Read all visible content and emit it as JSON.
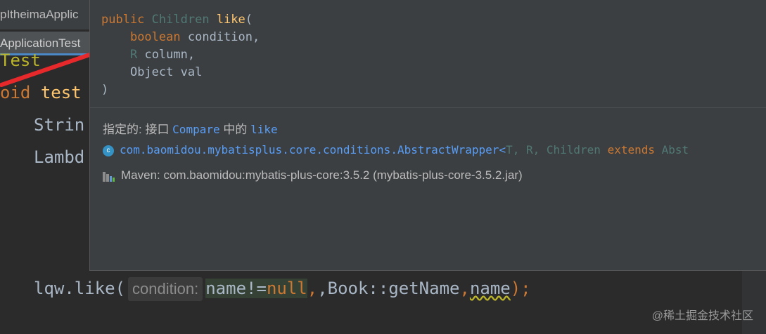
{
  "editor": {
    "tab_top": "pItheimaApplic",
    "tab_active": "ApplicationTest",
    "lines": {
      "l1": "Test",
      "l2_kw": "oid",
      "l2_fn": "test",
      "l3": "Strin",
      "l4": "Lambd"
    },
    "bottom_line": {
      "prefix": "lqw.like(",
      "hint": "condition:",
      "arg1": "name!=",
      "null": "null",
      "sep1": ",Book::getName",
      "sep2": ",",
      "arg3": "name",
      "suffix": ");"
    }
  },
  "popup": {
    "signature": {
      "kw_public": "public",
      "type_return": "Children",
      "method": "like",
      "open_paren": "(",
      "p1_kw": "boolean",
      "p1_name": "condition,",
      "p2_type": "R",
      "p2_name": "column,",
      "p3": "Object val",
      "close_paren": ")"
    },
    "specified": {
      "label": "指定的: 接口 ",
      "iface": "Compare",
      "middle": " 中的 ",
      "method": "like"
    },
    "class_line": {
      "icon": "c",
      "path": "com.baomidou.mybatisplus.core.conditions.AbstractWrapper<",
      "t": "T, R, Children",
      "kw_extends": " extends ",
      "rest": "Abst"
    },
    "maven": "Maven: com.baomidou:mybatis-plus-core:3.5.2 (mybatis-plus-core-3.5.2.jar)"
  },
  "watermark": "@稀土掘金技术社区",
  "colors": {
    "arrow": "#e8292b",
    "link": "#589df6",
    "keyword": "#cc7832"
  }
}
